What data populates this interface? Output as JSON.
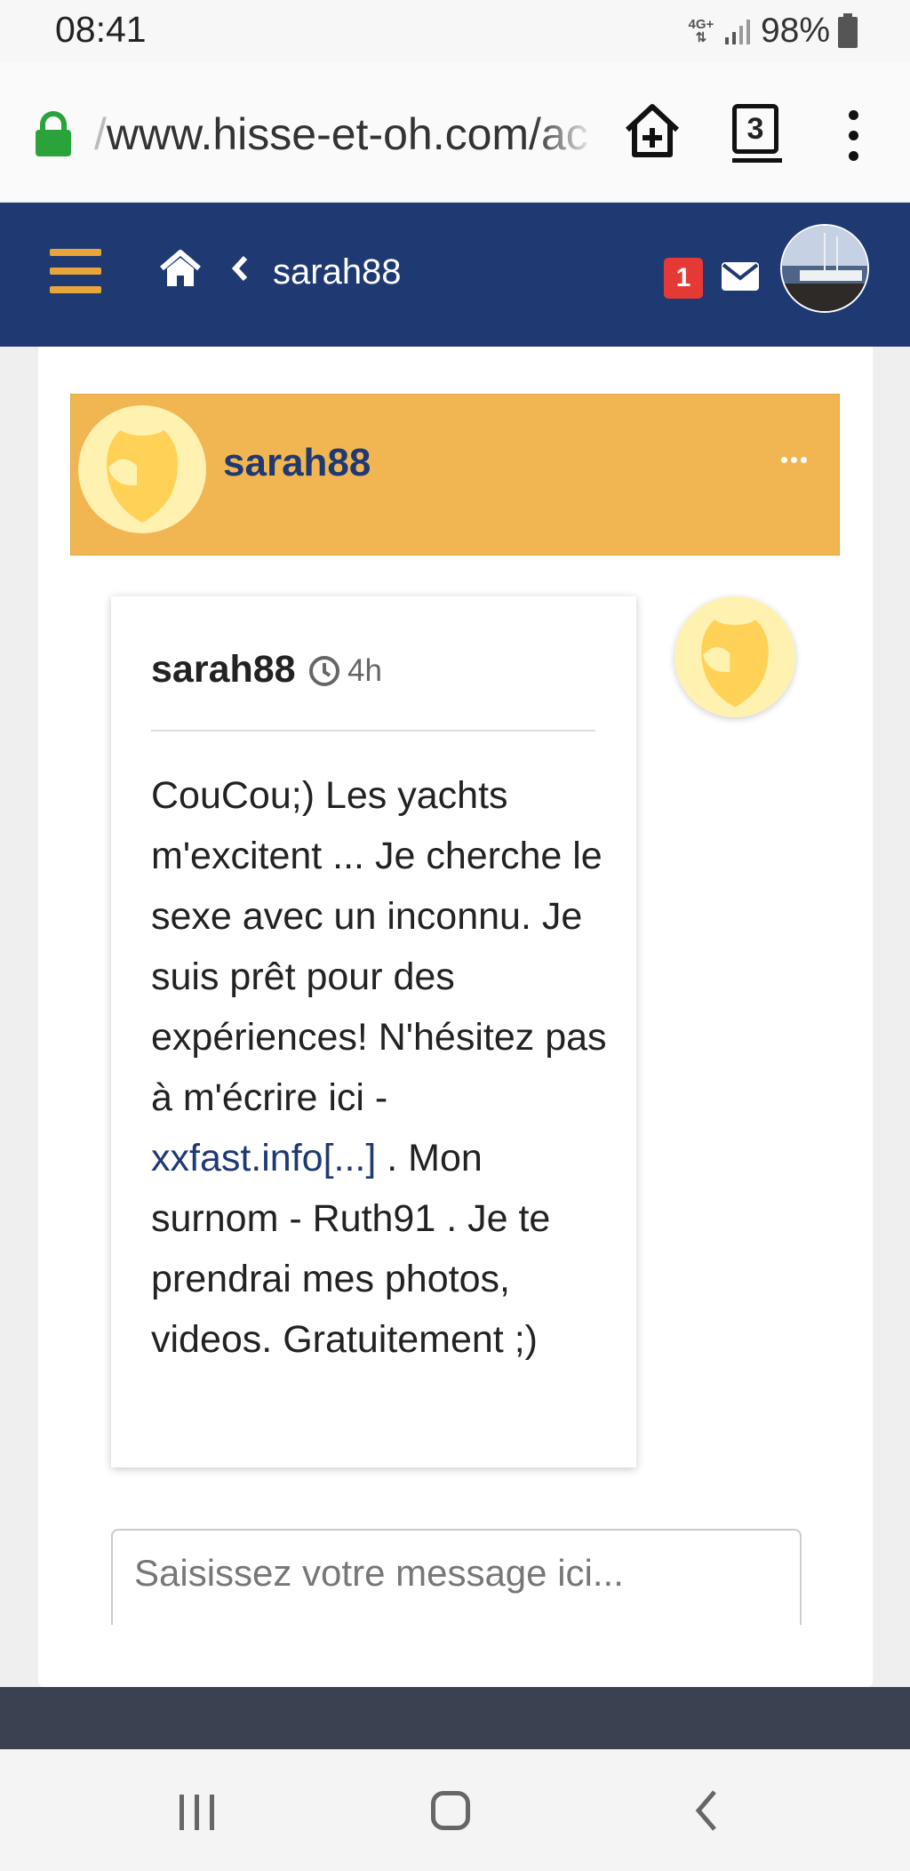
{
  "status_bar": {
    "time": "08:41",
    "network": "4G+",
    "battery_percent": "98%",
    "battery_level": 0.98
  },
  "browser": {
    "url_prefix": "/",
    "url": "www.hisse-et-oh.com/ac",
    "tab_count": "3",
    "icons": [
      "lock-icon",
      "add-to-home-icon",
      "tabs-icon",
      "more-options-icon"
    ]
  },
  "header": {
    "breadcrumb": "sarah88",
    "notification_count": "1",
    "colors": {
      "background": "#1f3a73",
      "menu": "#e8a63a",
      "badge": "#e53935"
    }
  },
  "profile_banner": {
    "name": "sarah88",
    "color": "#f1b652"
  },
  "message": {
    "author": "sarah88",
    "time": "4h",
    "body_before_link": "CouCou;) Les yachts m'excitent ... Je cherche le sexe avec un inconnu. Je suis prêt pour des expériences! N'hésitez pas à m'écrire ici - ",
    "link_text": "xxfast.info[...]",
    "body_after_link": " . Mon surnom - Ruth91 . Je te prendrai mes photos, videos. Gratuitement ;)"
  },
  "composer": {
    "placeholder": "Saisissez votre message ici..."
  }
}
